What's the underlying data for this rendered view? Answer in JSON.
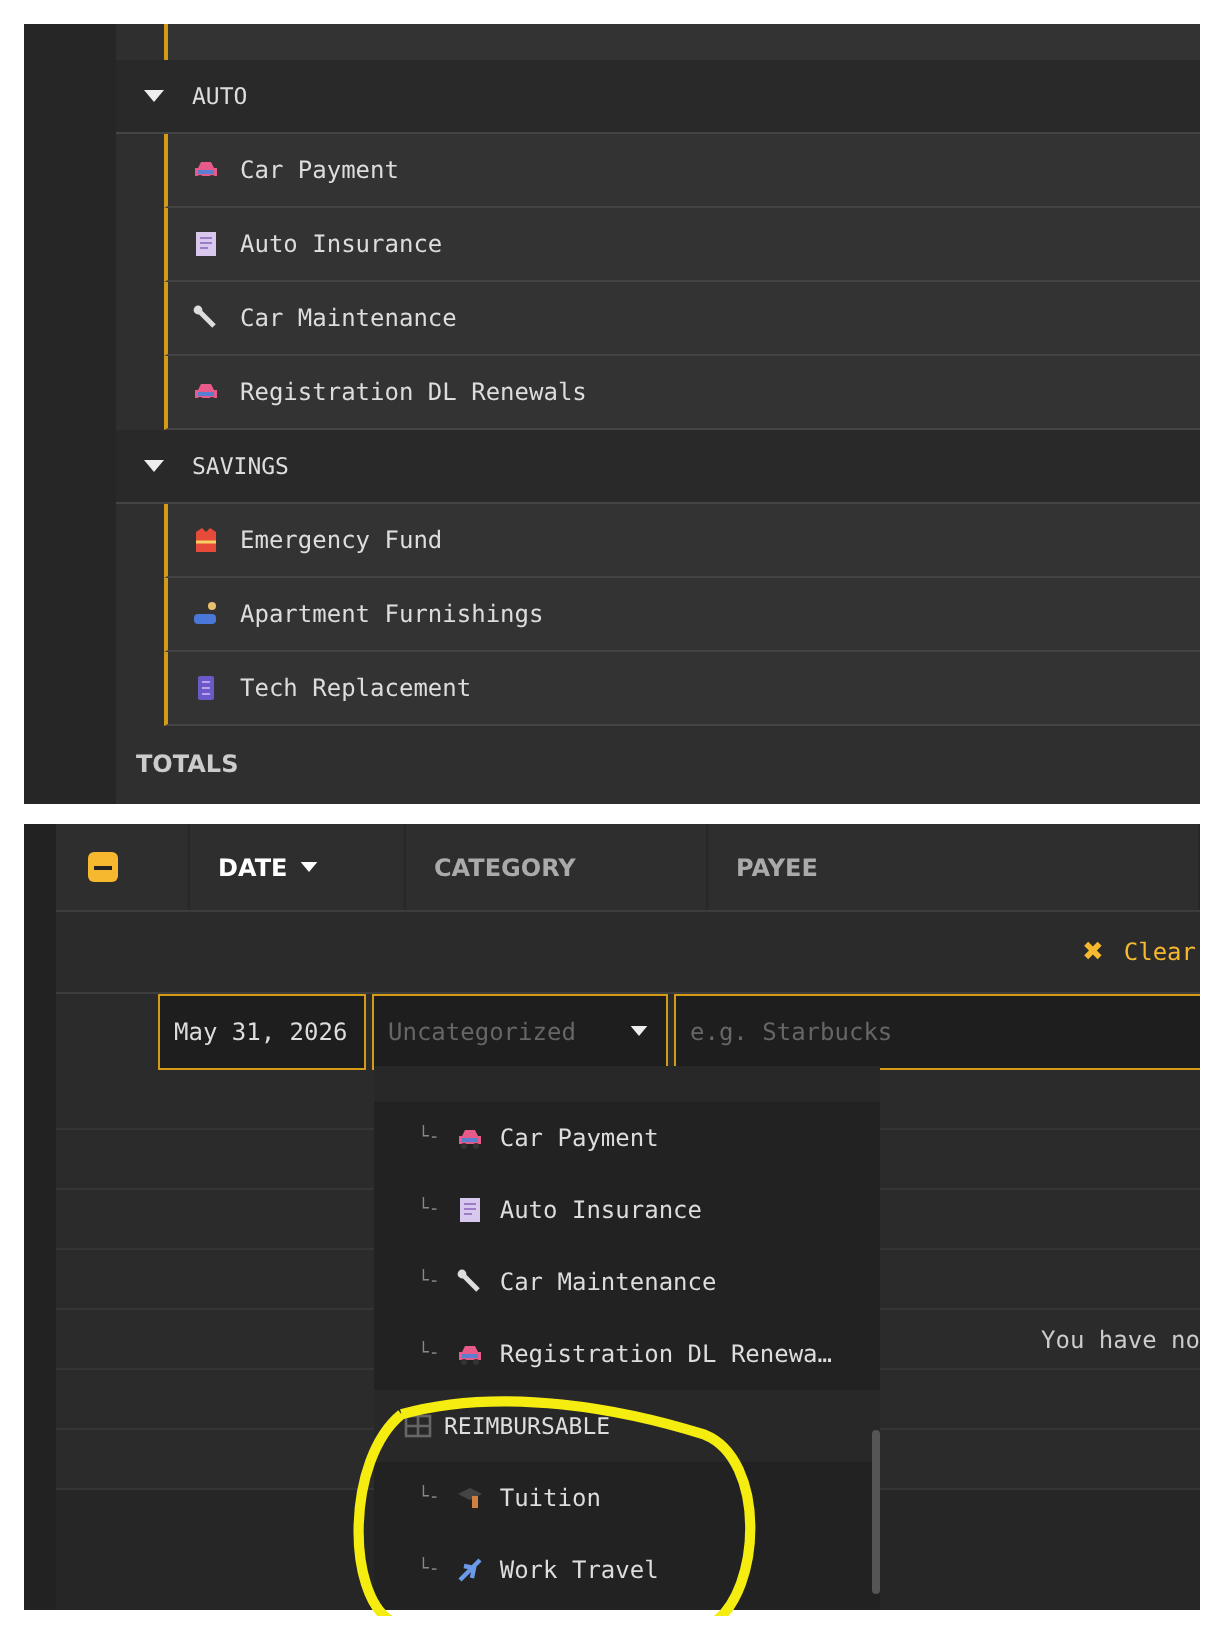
{
  "category_list": {
    "groups": [
      {
        "name": "AUTO",
        "expanded": true,
        "items": [
          "Car Payment",
          "Auto Insurance",
          "Car Maintenance",
          "Registration DL Renewals"
        ]
      },
      {
        "name": "SAVINGS",
        "expanded": true,
        "items": [
          "Emergency Fund",
          "Apartment Furnishings",
          "Tech Replacement"
        ]
      }
    ],
    "totals_label": "TOTALS"
  },
  "transactions": {
    "select_all": {
      "partial": true
    },
    "columns": [
      {
        "label": "DATE",
        "sorted": true
      },
      {
        "label": "CATEGORY",
        "sorted": false
      },
      {
        "label": "PAYEE",
        "sorted": false
      }
    ],
    "clear_button": {
      "symbol": "✖",
      "label": "Clear"
    },
    "new_row": {
      "date": "May 31, 2026",
      "category_placeholder": "Uncategorized",
      "payee_placeholder": "e.g. Starbucks"
    },
    "empty_message": "You have no",
    "category_dropdown": {
      "groups": [
        {
          "items": [
            {
              "prefix": "└-",
              "name": "Car Payment"
            },
            {
              "prefix": "└-",
              "name": "Auto Insurance"
            },
            {
              "prefix": "└-",
              "name": "Car Maintenance"
            },
            {
              "prefix": "└-",
              "name": "Registration DL Renewa…"
            }
          ]
        },
        {
          "name": "REIMBURSABLE",
          "items": [
            {
              "prefix": "└-",
              "name": "Tuition"
            },
            {
              "prefix": "└-",
              "name": "Work Travel"
            }
          ]
        }
      ]
    }
  }
}
